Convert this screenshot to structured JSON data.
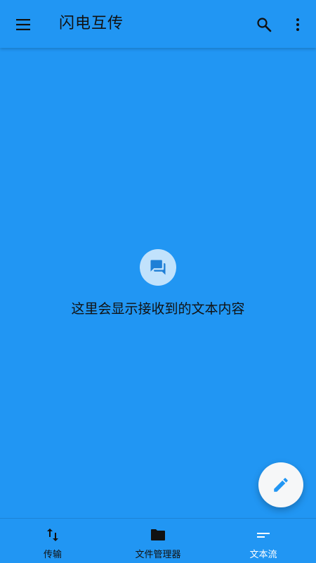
{
  "app_bar": {
    "title": "闪电互传",
    "menu_icon": "hamburger-menu-icon",
    "search_icon": "search-icon",
    "more_icon": "more-vert-icon"
  },
  "empty_state": {
    "icon": "chat-bubbles-icon",
    "message": "这里会显示接收到的文本内容"
  },
  "fab": {
    "icon": "pencil-edit-icon"
  },
  "bottom_nav": {
    "items": [
      {
        "label": "传输",
        "icon": "swap-vertical-arrows-icon",
        "active": false
      },
      {
        "label": "文件管理器",
        "icon": "folder-icon",
        "active": false
      },
      {
        "label": "文本流",
        "icon": "short-text-icon",
        "active": true
      }
    ]
  },
  "colors": {
    "primary": "#2196F3",
    "text": "#111111",
    "fab_background": "#F6F7F8",
    "active_nav_label": "#FFFFFF"
  }
}
